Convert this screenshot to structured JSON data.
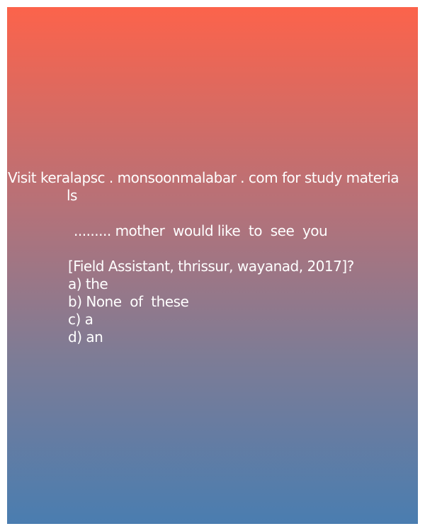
{
  "promo": {
    "line1": "Visit keralapsc . monsoonmalabar . com for study materia",
    "line2": "ls"
  },
  "question": {
    "text": "......... mother  would like  to  see  you",
    "source": "[Field Assistant, thrissur, wayanad, 2017]?"
  },
  "options": {
    "a": "a) the",
    "b": "b) None  of  these",
    "c": "c) a",
    "d": "d) an"
  },
  "colors": {
    "gradient_top": "#fc634b",
    "gradient_bottom": "#4a7db0",
    "text": "#ffffff"
  }
}
